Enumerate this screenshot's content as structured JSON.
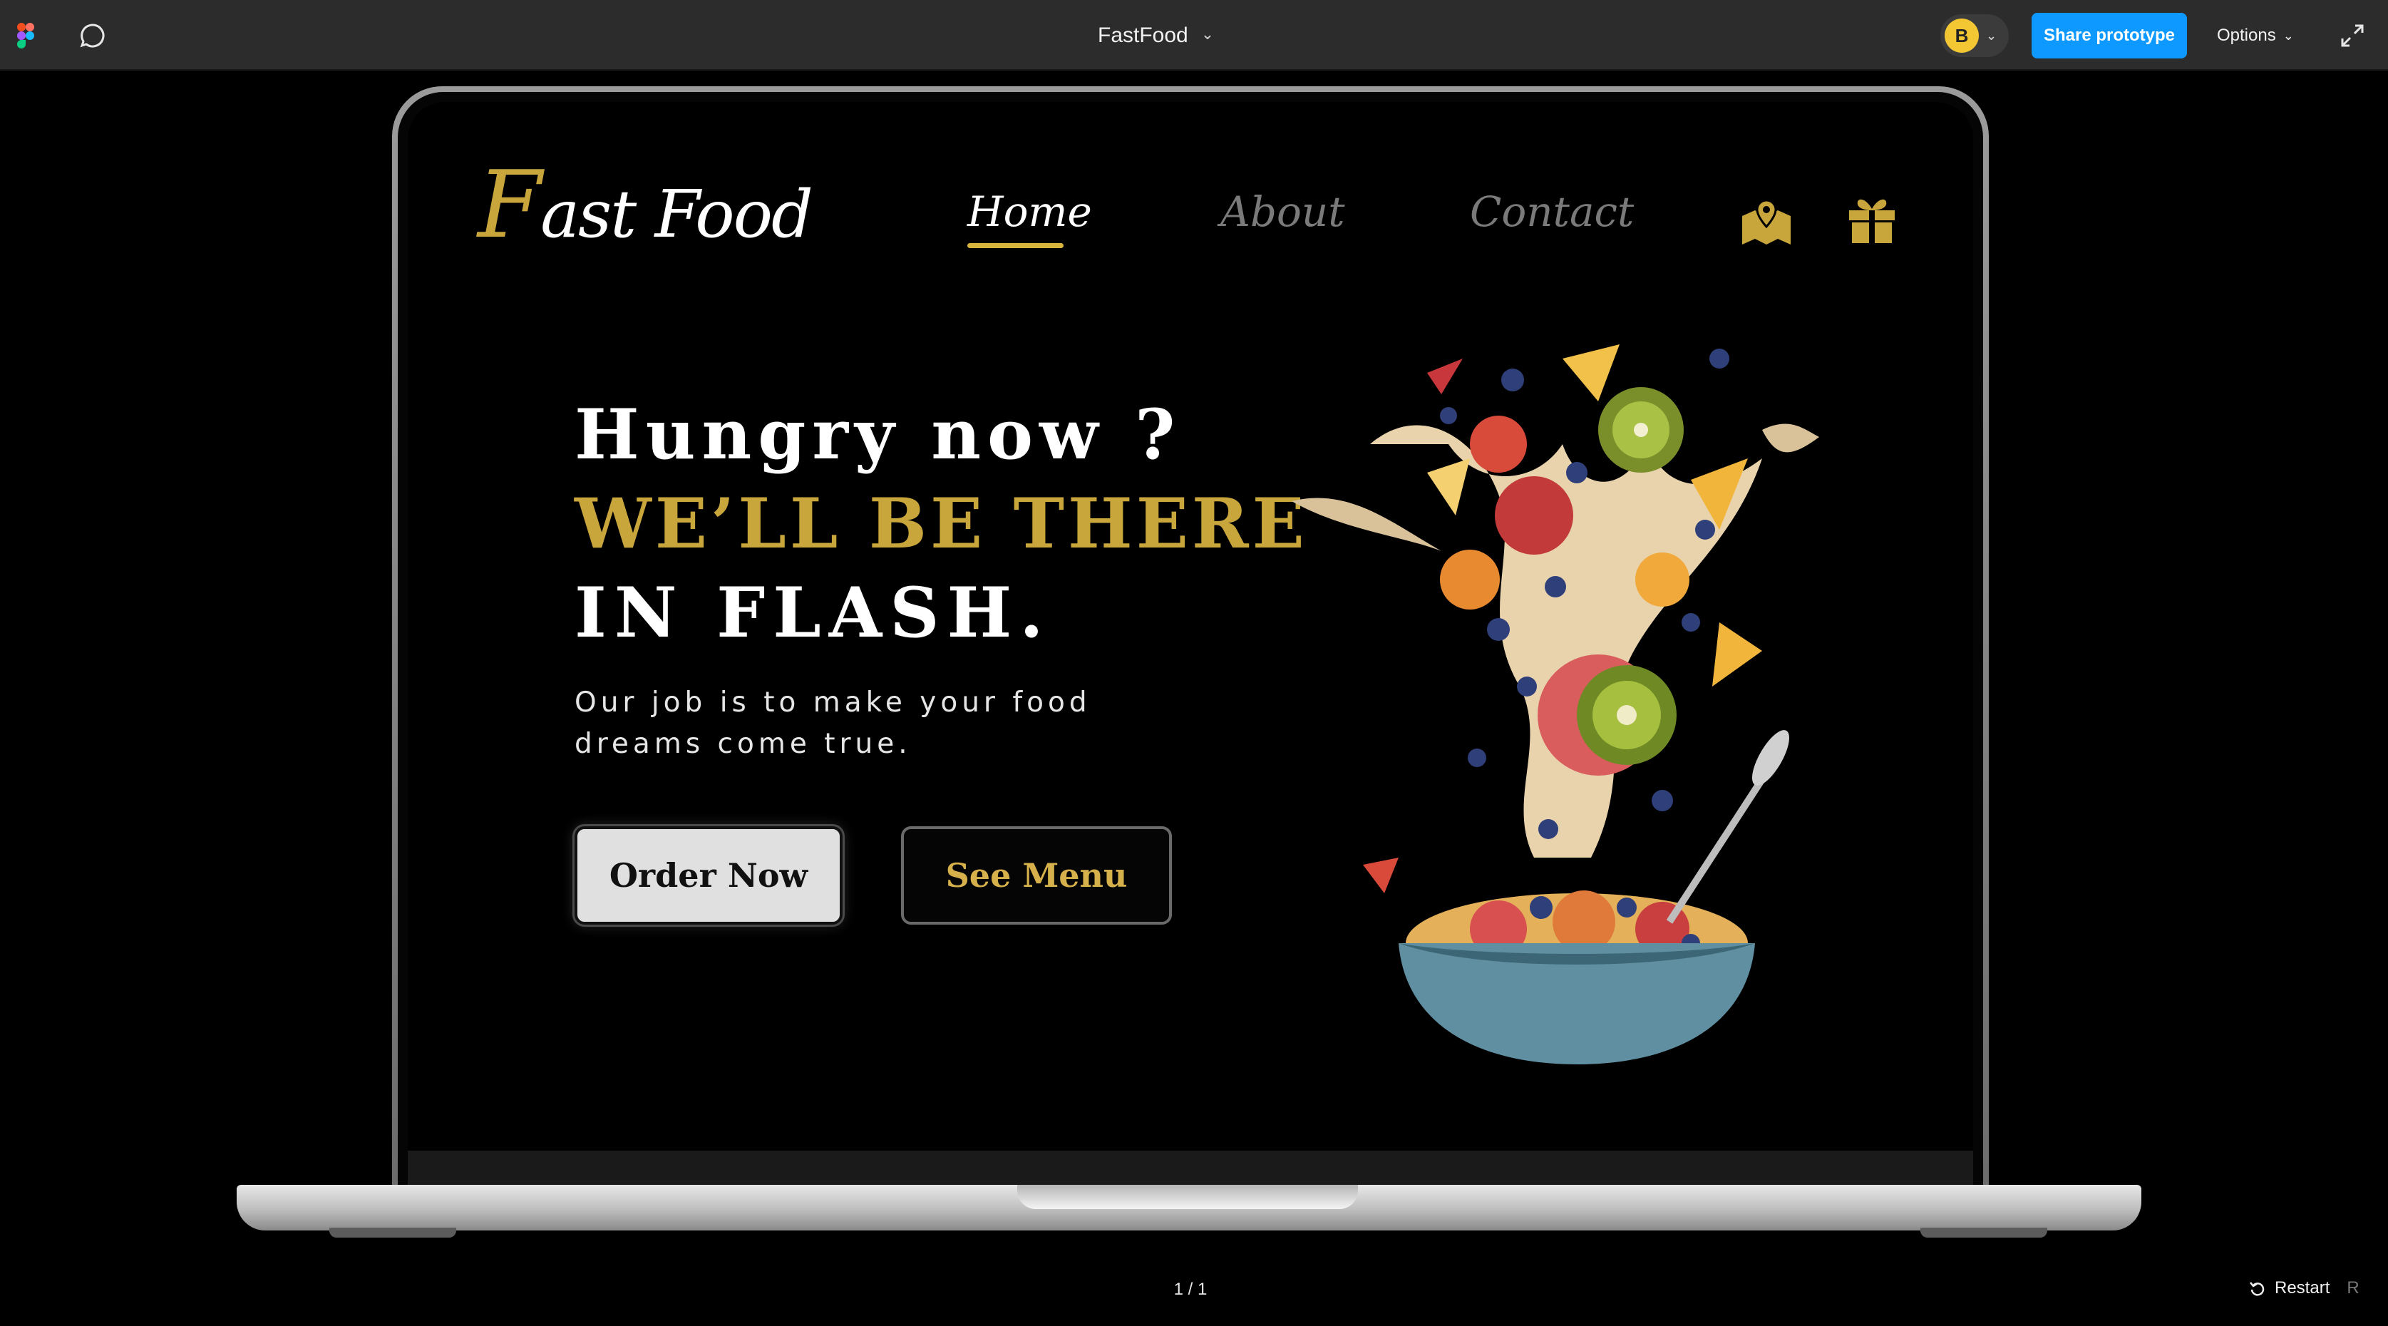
{
  "topbar": {
    "file_title": "FastFood",
    "avatar_initial": "B",
    "share_label": "Share prototype",
    "options_label": "Options"
  },
  "site": {
    "logo_first": "F",
    "logo_rest": "ast Food",
    "nav": {
      "home": "Home",
      "about": "About",
      "contact": "Contact"
    },
    "hero": {
      "line1": "Hungry now ?",
      "line2": "WE’LL BE THERE",
      "line3": "IN FLASH.",
      "tagline": "Our job is to make your food dreams come true."
    },
    "buttons": {
      "order": "Order Now",
      "menu": "See Menu"
    }
  },
  "footer": {
    "page_counter": "1 / 1",
    "restart_label": "Restart",
    "restart_key": "R"
  },
  "colors": {
    "gold": "#c9a63c",
    "share_blue": "#0d99ff",
    "avatar_yellow": "#f3c634"
  },
  "icons": [
    "figma-logo-icon",
    "comment-icon",
    "chevron-down-icon",
    "expand-icon",
    "map-icon",
    "gift-icon",
    "restart-icon"
  ]
}
